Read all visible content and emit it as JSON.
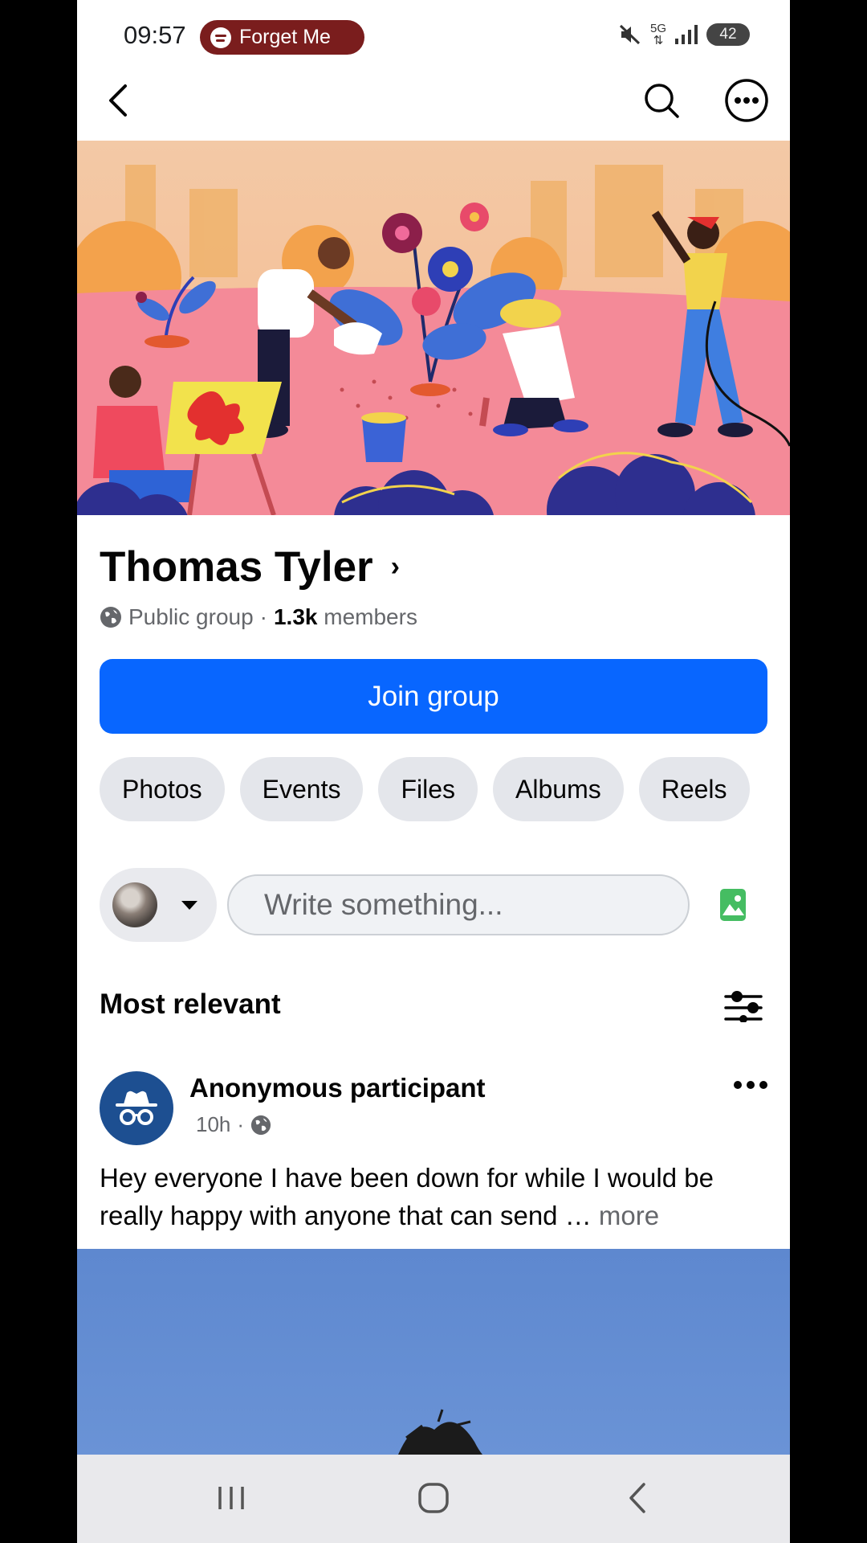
{
  "status_bar": {
    "time": "09:57",
    "media_label": "Forget Me",
    "network": "5G",
    "battery": "42"
  },
  "top_nav": {
    "back_icon": "chevron-left-icon",
    "search_icon": "search-icon",
    "more_icon": "more-circle-icon"
  },
  "group": {
    "name": "Thomas Tyler",
    "chevron": "›",
    "privacy": "Public group",
    "separator": "·",
    "member_count": "1.3k",
    "members_label": "members",
    "join_label": "Join group"
  },
  "chips": [
    "Photos",
    "Events",
    "Files",
    "Albums",
    "Reels"
  ],
  "composer": {
    "placeholder": "Write something..."
  },
  "sort": {
    "label": "Most relevant"
  },
  "post": {
    "author": "Anonymous participant",
    "time": "10h",
    "separator": "·",
    "text": "Hey everyone I have been down for while I would be really happy with anyone that can send … ",
    "more_label": "more"
  },
  "colors": {
    "brand_blue": "#0866ff",
    "chip_bg": "#e4e6eb",
    "photo_green": "#45bd62",
    "media_pill": "#7a1d1d"
  }
}
